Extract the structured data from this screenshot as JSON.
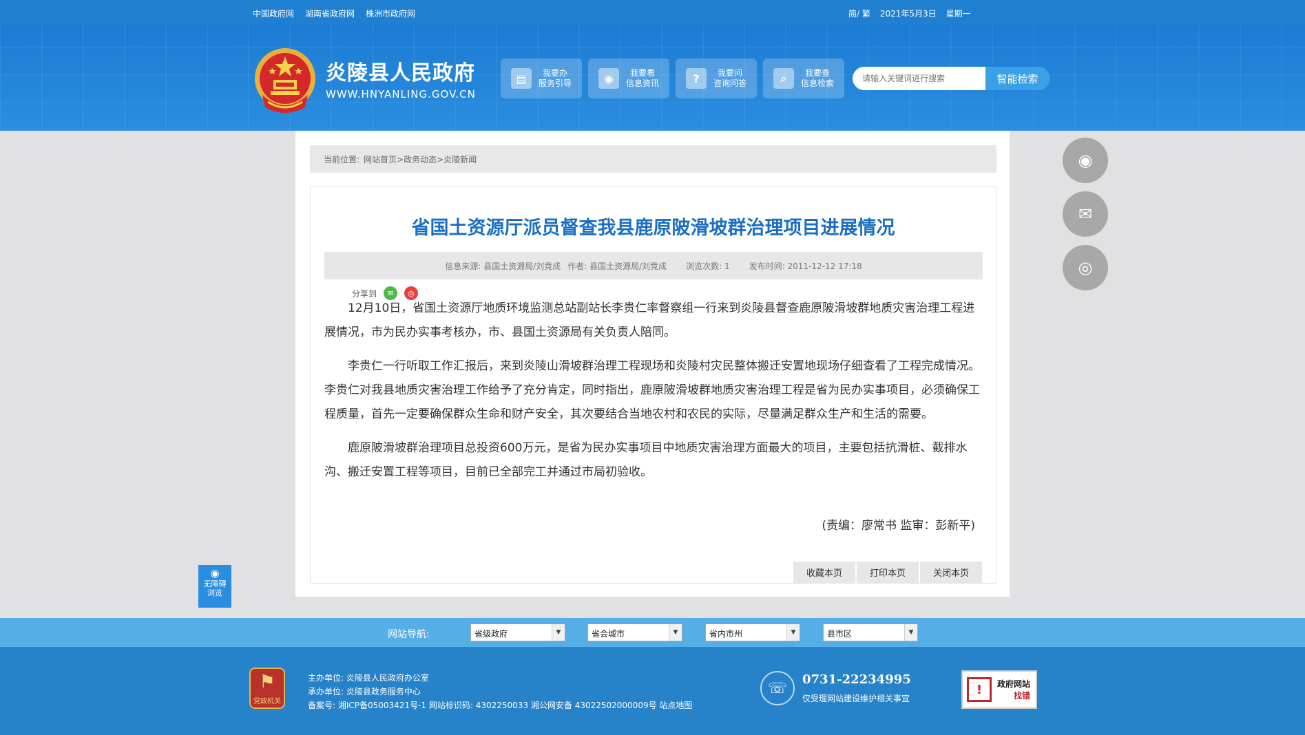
{
  "topbar": {
    "links": [
      "中国政府网",
      "湖南省政府网",
      "株洲市政府网"
    ],
    "lang": "简/ 繁",
    "date": "2021年5月3日",
    "weekday": "星期一"
  },
  "header": {
    "title": "炎陵县人民政府",
    "url": "WWW.HNYANLING.GOV.CN",
    "quick": [
      {
        "line1": "我要办",
        "line2": "服务引导",
        "icon": "document-icon"
      },
      {
        "line1": "我要看",
        "line2": "信息资讯",
        "icon": "eye-icon"
      },
      {
        "line1": "我要问",
        "line2": "咨询问答",
        "icon": "question-icon"
      },
      {
        "line1": "我要查",
        "line2": "信息检索",
        "icon": "search-icon"
      }
    ],
    "search_placeholder": "请输入关键词进行搜索",
    "search_button": "智能检索"
  },
  "breadcrumb": {
    "label": "当前位置:",
    "items": [
      "网站首页",
      ">政务动态",
      ">炎陵新闻"
    ]
  },
  "article": {
    "title": "省国土资源厅派员督查我县鹿原陂滑坡群治理项目进展情况",
    "meta": {
      "source": "信息来源: 县国土资源局/刘竞成",
      "author": "作者: 县国土资源局/刘竞成",
      "views": "浏览次数: 1",
      "published": "发布时间: 2011-12-12 17:18"
    },
    "share_label": "分享到",
    "paragraphs": [
      "12月10日，省国土资源厅地质环境监测总站副站长李贵仁率督察组一行来到炎陵县督查鹿原陂滑坡群地质灾害治理工程进展情况，市为民办实事考核办，市、县国土资源局有关负责人陪同。",
      "李贵仁一行听取工作汇报后，来到炎陵山滑坡群治理工程现场和炎陵村灾民整体搬迁安置地现场仔细查看了工程完成情况。李贵仁对我县地质灾害治理工作给予了充分肯定，同时指出，鹿原陂滑坡群地质灾害治理工程是省为民办实事项目，必须确保工程质量，首先一定要确保群众生命和财产安全，其次要结合当地农村和农民的实际，尽量满足群众生产和生活的需要。",
      "鹿原陂滑坡群治理项目总投资600万元，是省为民办实事项目中地质灾害治理方面最大的项目，主要包括抗滑桩、截排水沟、搬迁安置工程等项目，目前已全部完工并通过市局初验收。"
    ],
    "editor": "(责编：廖常书  监审：彭新平)",
    "tools": [
      "收藏本页",
      "打印本页",
      "关闭本页"
    ]
  },
  "accessibility": {
    "line1": "无障碍",
    "line2": "浏览"
  },
  "footer_nav": {
    "label": "网站导航:",
    "selects": [
      "省级政府",
      "省会城市",
      "省内市州",
      "县市区"
    ]
  },
  "footer": {
    "host": "主办单位: 炎陵县人民政府办公室",
    "organizer": "承办单位: 炎陵县政务服务中心",
    "record": "备案号: 湘ICP备05003421号-1 网站标识码: 4302250033 湘公网安备 43022502000009号 站点地图",
    "phone": "0731-22234995",
    "phone_note": "仅受理网站建设维护相关事宜",
    "logo_text": "党政机关",
    "err_line1": "政府网站",
    "err_line2": "找错"
  }
}
